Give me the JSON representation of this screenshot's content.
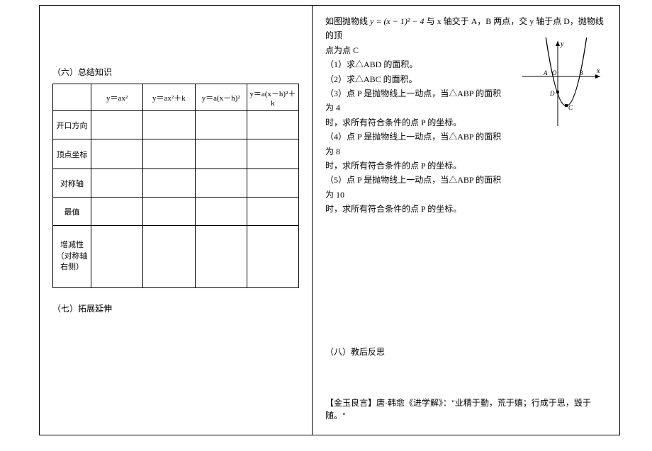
{
  "left": {
    "section6_title": "（六）总结知识",
    "table_headers": [
      "",
      "y＝ax²",
      "y＝ax²＋k",
      "y＝a(x－h)²",
      "y＝a(x－h)²＋k"
    ],
    "row_labels": [
      "开口方向",
      "顶点坐标",
      "对称轴",
      "最值",
      "增减性\n（对称轴\n右侧）"
    ],
    "section7_title": "（七）拓展延伸"
  },
  "right": {
    "intro_line1": "如图抛物线",
    "intro_formula": "y = (x − 1)² − 4",
    "intro_line2": "与 x 轴交于 A，B 两点，交 y 轴于点 D，抛物线的顶",
    "intro_line3": "点为点 C",
    "q1": "（1）求△ABD 的面积。",
    "q2": "（2）求△ABC 的面积。",
    "q3a": "（3）点 P 是抛物线上一动点，当△ABP 的面积为 4",
    "q3b": "时，求所有符合条件的点 P 的坐标。",
    "q4a": "（4）点 P 是抛物线上一动点，当△ABP 的面积为 8",
    "q4b": "时，求所有符合条件的点 P 的坐标。",
    "q5a": "（5）点 P 是抛物线上一动点，当△ABP 的面积为 10",
    "q5b": "时，求所有符合条件的点 P 的坐标。",
    "axis_y": "y",
    "axis_x": "x",
    "label_A": "A",
    "label_O": "O",
    "label_B": "B",
    "label_D": "D",
    "label_C": "C",
    "section8_title": "（八）教后反思",
    "quote": "【金玉良言】唐·韩愈《进学解》：\"业精于勤，荒于嬉；行成于思，毁于随。\""
  }
}
